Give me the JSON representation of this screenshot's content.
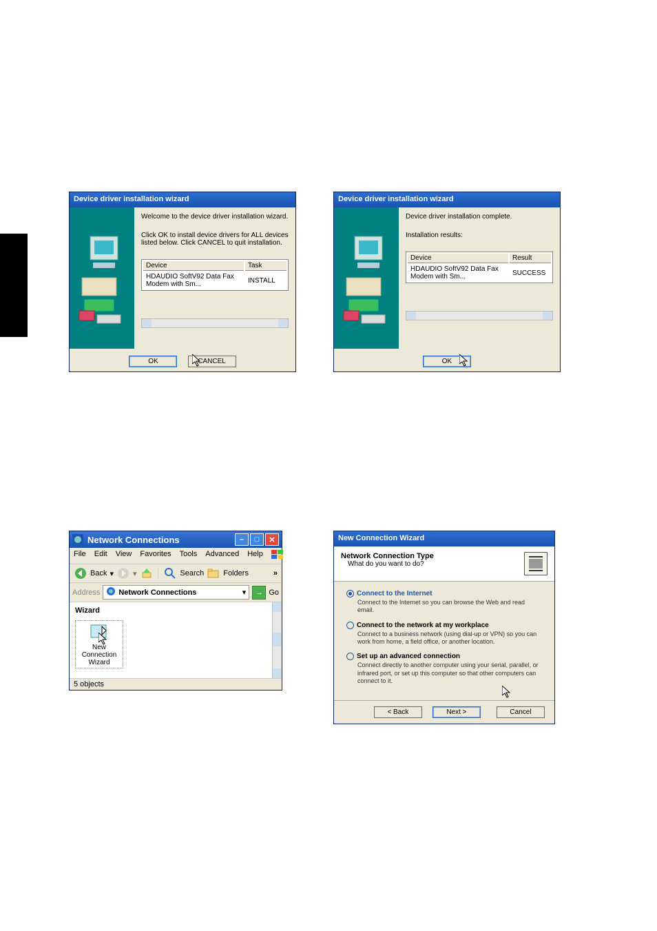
{
  "driver1": {
    "title": "Device driver installation wizard",
    "line1": "Welcome to the device driver installation wizard.",
    "line2": "Click OK to install device drivers for ALL devices listed below. Click CANCEL to quit installation.",
    "th1": "Device",
    "th2": "Task",
    "td1": "HDAUDIO SoftV92 Data Fax Modem with Sm...",
    "td2": "INSTALL",
    "ok": "OK",
    "cancel": "CANCEL"
  },
  "driver2": {
    "title": "Device driver installation wizard",
    "line1": "Device driver installation complete.",
    "line2": "Installation results:",
    "th1": "Device",
    "th2": "Result",
    "td1": "HDAUDIO SoftV92 Data Fax Modem with Sm...",
    "td2": "SUCCESS",
    "ok": "OK"
  },
  "netconn": {
    "title": "Network Connections",
    "menu": {
      "file": "File",
      "edit": "Edit",
      "view": "View",
      "fav": "Favorites",
      "tools": "Tools",
      "adv": "Advanced",
      "help": "Help"
    },
    "tb": {
      "back": "Back",
      "search": "Search",
      "folders": "Folders",
      "chev": "»"
    },
    "addr": {
      "label": "Address",
      "value": "Network Connections",
      "go": "Go"
    },
    "cat": "Wizard",
    "item": "New Connection Wizard",
    "status": "5 objects"
  },
  "wizard2": {
    "title": "New Connection Wizard",
    "hdr_t": "Network Connection Type",
    "hdr_s": "What do you want to do?",
    "o1_l": "Connect to the Internet",
    "o1_d": "Connect to the Internet so you can browse the Web and read email.",
    "o2_l": "Connect to the network at my workplace",
    "o2_d": "Connect to a business network (using dial-up or VPN) so you can work from home, a field office, or another location.",
    "o3_l": "Set up an advanced connection",
    "o3_d": "Connect directly to another computer using your serial, parallel, or infrared port, or set up this computer so that other computers can connect to it.",
    "back": "< Back",
    "next": "Next >",
    "cancel": "Cancel"
  }
}
